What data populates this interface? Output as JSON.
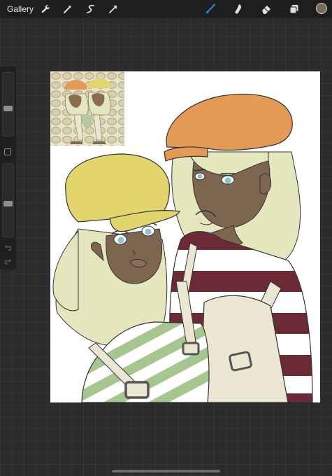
{
  "topbar": {
    "gallery_label": "Gallery",
    "left_tools": [
      "wrench-icon",
      "magic-wand-icon",
      "selection-icon",
      "transform-icon"
    ],
    "right_tools": [
      "brush-icon",
      "smudge-icon",
      "eraser-icon",
      "layers-icon"
    ],
    "active_tool": "brush-icon",
    "accent_color": "#3d7de0",
    "current_color": "#7a6a55"
  },
  "sidebar": {
    "brush_size_level": 0.42,
    "opacity_level": 0.45
  },
  "canvas": {
    "background": "#ffffff",
    "colors": {
      "skin": "#7d6550",
      "hair": "#e4e6bd",
      "yellow_cap": "#e2d56d",
      "orange_cap": "#e29a55",
      "red_stripe": "#6b2a36",
      "green_stripe": "#a7c58f",
      "overall": "#ebe6d2",
      "eye": "#8fc2d1"
    }
  }
}
